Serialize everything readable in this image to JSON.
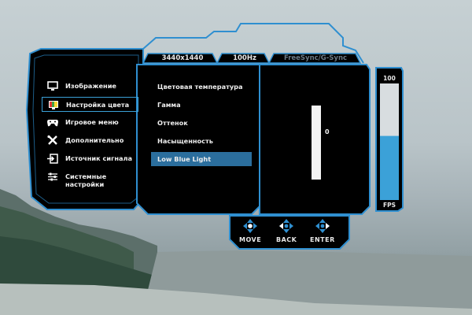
{
  "status_tabs": [
    "3440x1440",
    "100Hz",
    "FreeSync/G-Sync"
  ],
  "main_menu": [
    {
      "label": "Изображение",
      "icon": "monitor-icon"
    },
    {
      "label": "Настройка цвета",
      "icon": "color-palette-icon",
      "selected": true
    },
    {
      "label": "Игровое меню",
      "icon": "gamepad-icon"
    },
    {
      "label": "Дополнительно",
      "icon": "tools-icon"
    },
    {
      "label": "Источник сигнала",
      "icon": "input-source-icon"
    },
    {
      "label": "Системные настройки",
      "icon": "sliders-icon"
    }
  ],
  "sub_menu": [
    {
      "label": "Цветовая температура"
    },
    {
      "label": "Гамма"
    },
    {
      "label": "Оттенок"
    },
    {
      "label": "Насыщенность"
    },
    {
      "label": "Low Blue Light",
      "selected": true
    }
  ],
  "slider": {
    "value_text": "0",
    "level": 0
  },
  "fps_meter": {
    "max_text": "100",
    "label": "FPS",
    "level": 0.55
  },
  "nav": [
    {
      "label": "MOVE",
      "icon": "dpad-move-icon"
    },
    {
      "label": "BACK",
      "icon": "dpad-back-icon"
    },
    {
      "label": "ENTER",
      "icon": "dpad-enter-icon"
    }
  ],
  "colors": {
    "accent": "#3ba1d8",
    "selected_bg": "#2b6e9d",
    "panel": "#000000",
    "frame": "#2f8fd0"
  }
}
